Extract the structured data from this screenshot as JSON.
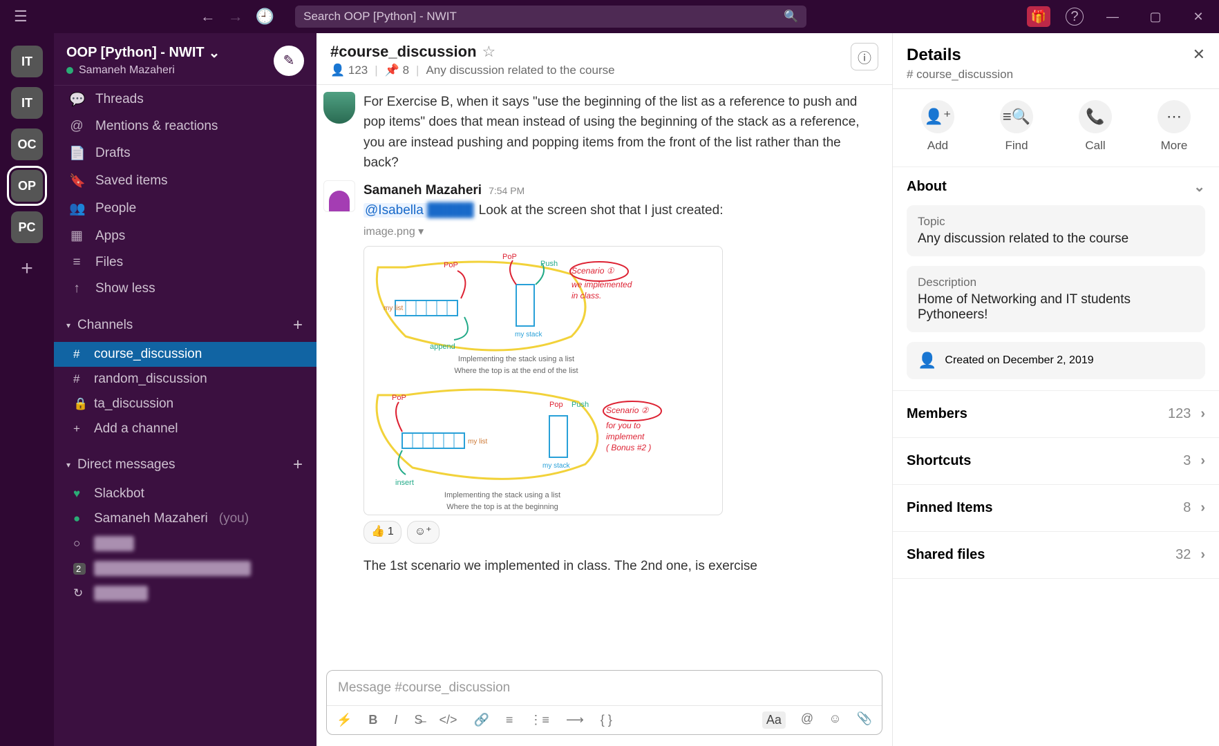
{
  "search_placeholder": "Search OOP [Python] - NWIT",
  "rail": [
    "IT",
    "IT",
    "OC",
    "OP",
    "PC"
  ],
  "workspace": {
    "name": "OOP [Python] - NWIT",
    "user": "Samaneh Mazaheri"
  },
  "nav": [
    "Threads",
    "Mentions & reactions",
    "Drafts",
    "Saved items",
    "People",
    "Apps",
    "Files",
    "Show less"
  ],
  "sections": {
    "channels": "Channels",
    "dms": "Direct messages"
  },
  "channels": [
    {
      "pre": "#",
      "label": "course_discussion",
      "sel": true
    },
    {
      "pre": "#",
      "label": "random_discussion"
    },
    {
      "pre": "🔒",
      "label": "ta_discussion"
    },
    {
      "pre": "+",
      "label": "Add a channel"
    }
  ],
  "dms": [
    {
      "pre": "♥",
      "label": "Slackbot"
    },
    {
      "pre": "●",
      "label": "Samaneh Mazaheri",
      "you": "(you)"
    },
    {
      "pre": "○",
      "label": "Ajmain",
      "blur": true
    },
    {
      "pre": "2",
      "label": "Dawood, Mir Aamir Alikhan",
      "blur": true
    },
    {
      "pre": "↻",
      "label": "Kevin Lia",
      "blur": true
    }
  ],
  "channel": {
    "name": "#course_discussion",
    "members": "123",
    "pins": "8",
    "topic": "Any discussion related to the course"
  },
  "messages": {
    "m1": "For Exercise B, when it says \"use the beginning of the list as a reference to push and pop items\" does that mean instead of using the beginning of the stack as a reference, you are instead pushing and popping items from the front of the list rather than the back?",
    "m2": {
      "name": "Samaneh Mazaheri",
      "time": "7:54 PM",
      "mention": "@Isabella",
      "text": " Look at the screen shot that I just created:",
      "file": "image.png ▾",
      "react_count": "1",
      "follow": "The 1st scenario we implemented in class. The 2nd one, is exercise"
    }
  },
  "img": {
    "cap1a": "Implementing the stack using a list",
    "cap1b": "Where the top is at the end of the list",
    "cap2a": "Implementing the stack using a list",
    "cap2b": "Where the top is at the beginning",
    "s1": "Scenario ①",
    "s1b": "we implemented",
    "s1c": "in class.",
    "s2": "Scenario ②",
    "s2b": "for you to",
    "s2c": "implement",
    "s2d": "( Bonus #2 )"
  },
  "composer": {
    "placeholder": "Message #course_discussion"
  },
  "details": {
    "title": "Details",
    "sub": "# course_discussion",
    "actions": [
      "Add",
      "Find",
      "Call",
      "More"
    ],
    "about": "About",
    "topic_l": "Topic",
    "topic_v": "Any discussion related to the course",
    "desc_l": "Description",
    "desc_v": "Home of Networking and IT students Pythoneers!",
    "created": "Created on December 2, 2019",
    "rows": [
      {
        "l": "Members",
        "n": "123"
      },
      {
        "l": "Shortcuts",
        "n": "3"
      },
      {
        "l": "Pinned Items",
        "n": "8"
      },
      {
        "l": "Shared files",
        "n": "32"
      }
    ]
  }
}
